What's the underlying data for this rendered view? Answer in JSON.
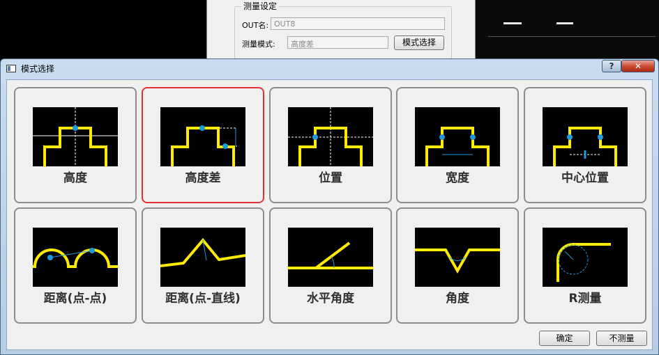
{
  "background_dialog": {
    "group_title": "测量设定",
    "out_label": "OUT名:",
    "out_value": "OUT8",
    "mode_label": "测量模式:",
    "mode_value": "高度差",
    "mode_button": "模式选择"
  },
  "window": {
    "title": "模式选择",
    "help_label": "?",
    "close_label": "✕"
  },
  "modes": [
    {
      "label": "高度",
      "selected": false
    },
    {
      "label": "高度差",
      "selected": true
    },
    {
      "label": "位置",
      "selected": false
    },
    {
      "label": "宽度",
      "selected": false
    },
    {
      "label": "中心位置",
      "selected": false
    },
    {
      "label": "距离(点-点)",
      "selected": false
    },
    {
      "label": "距离(点-直线)",
      "selected": false
    },
    {
      "label": "水平角度",
      "selected": false
    },
    {
      "label": "角度",
      "selected": false
    },
    {
      "label": "R测量",
      "selected": false
    }
  ],
  "buttons": {
    "ok": "确定",
    "no_measure": "不测量"
  },
  "colors": {
    "profile": "#ffeb00",
    "marker": "#1e9bdc",
    "selected_border": "#e03232"
  }
}
